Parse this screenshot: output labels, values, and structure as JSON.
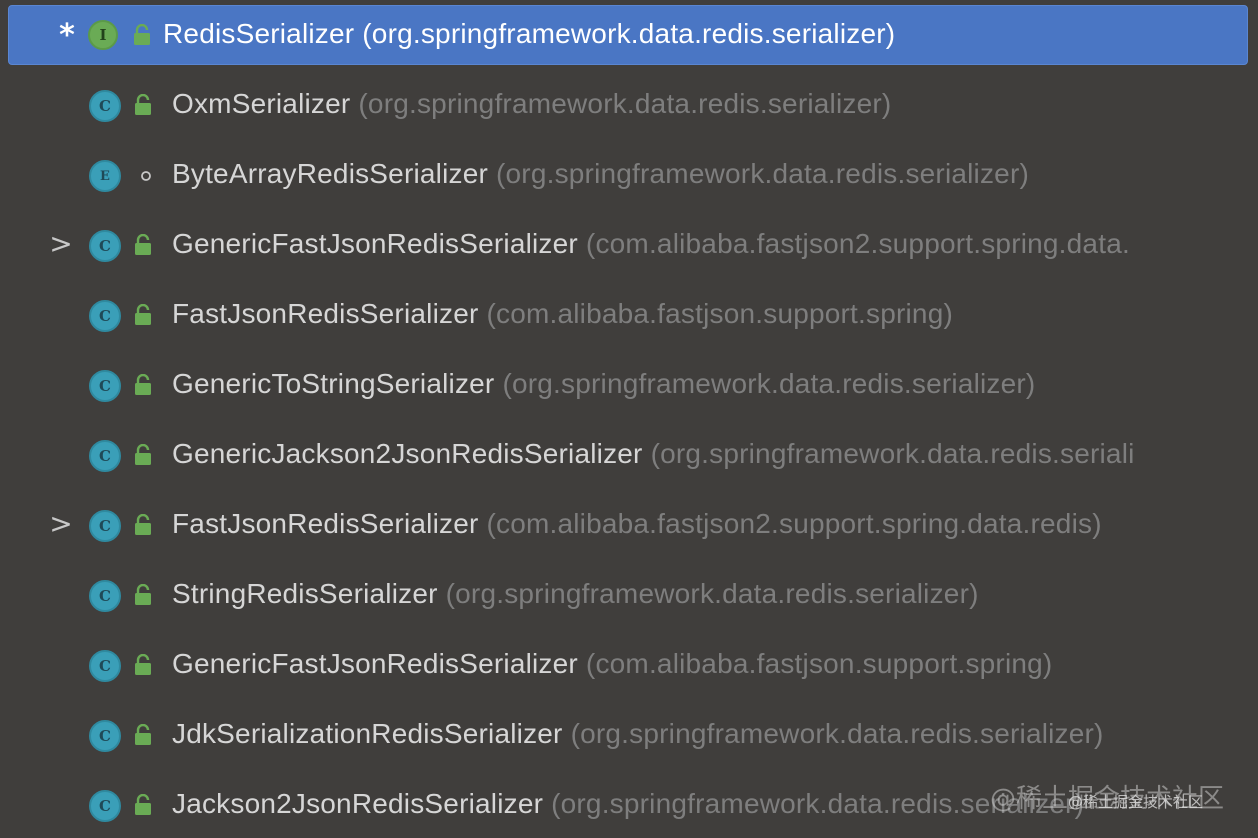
{
  "tree": {
    "items": [
      {
        "name": "RedisSerializer",
        "pkg": "(org.springframework.data.redis.serializer)",
        "kind": "I",
        "access": "lock",
        "prefix": "*",
        "selected": true
      },
      {
        "name": "OxmSerializer",
        "pkg": "(org.springframework.data.redis.serializer)",
        "kind": "C",
        "access": "lock",
        "prefix": ""
      },
      {
        "name": "ByteArrayRedisSerializer",
        "pkg": "(org.springframework.data.redis.serializer)",
        "kind": "E",
        "access": "dot",
        "prefix": ""
      },
      {
        "name": "GenericFastJsonRedisSerializer",
        "pkg": "(com.alibaba.fastjson2.support.spring.data.",
        "kind": "C",
        "access": "lock",
        "prefix": ">"
      },
      {
        "name": "FastJsonRedisSerializer",
        "pkg": "(com.alibaba.fastjson.support.spring)",
        "kind": "C",
        "access": "lock",
        "prefix": ""
      },
      {
        "name": "GenericToStringSerializer",
        "pkg": "(org.springframework.data.redis.serializer)",
        "kind": "C",
        "access": "lock",
        "prefix": ""
      },
      {
        "name": "GenericJackson2JsonRedisSerializer",
        "pkg": "(org.springframework.data.redis.seriali",
        "kind": "C",
        "access": "lock",
        "prefix": ""
      },
      {
        "name": "FastJsonRedisSerializer",
        "pkg": "(com.alibaba.fastjson2.support.spring.data.redis)",
        "kind": "C",
        "access": "lock",
        "prefix": ">"
      },
      {
        "name": "StringRedisSerializer",
        "pkg": "(org.springframework.data.redis.serializer)",
        "kind": "C",
        "access": "lock",
        "prefix": ""
      },
      {
        "name": "GenericFastJsonRedisSerializer",
        "pkg": "(com.alibaba.fastjson.support.spring)",
        "kind": "C",
        "access": "lock",
        "prefix": ""
      },
      {
        "name": "JdkSerializationRedisSerializer",
        "pkg": "(org.springframework.data.redis.serializer)",
        "kind": "C",
        "access": "lock",
        "prefix": ""
      },
      {
        "name": "Jackson2JsonRedisSerializer",
        "pkg": "(org.springframework.data.redis.serializer)",
        "kind": "C",
        "access": "lock",
        "prefix": ""
      }
    ]
  },
  "watermark": {
    "large": "@稀土掘金技术社区",
    "small": "@稀土掘金技术社区"
  },
  "colors": {
    "background": "#403e3c",
    "selection": "#4a76c4",
    "class_icon": "#3a9fb8",
    "interface_icon": "#6aab55",
    "lock_icon": "#6aab55",
    "name_text": "#d6d6d6",
    "package_text": "#7e7e7e"
  }
}
